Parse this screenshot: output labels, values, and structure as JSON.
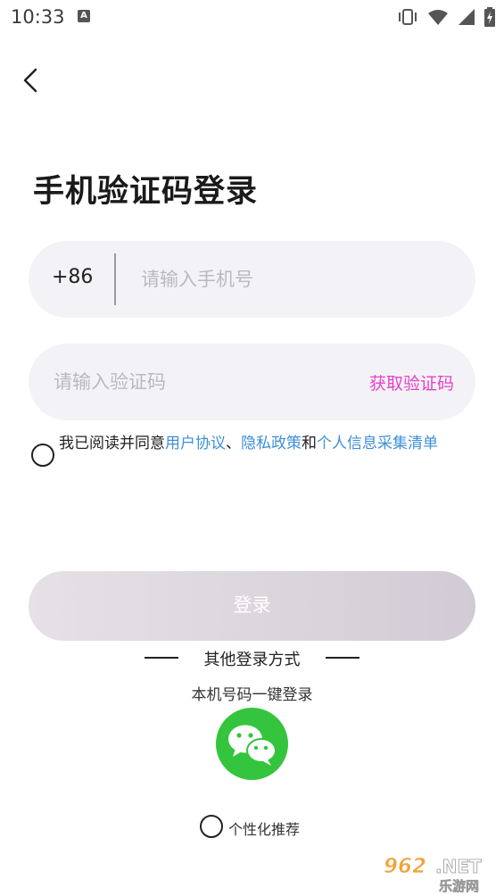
{
  "status_bar": {
    "time": "10:33",
    "notification_badge": "A"
  },
  "page": {
    "title": "手机验证码登录"
  },
  "phone_field": {
    "country_code": "+86",
    "placeholder": "请输入手机号",
    "value": ""
  },
  "code_field": {
    "placeholder": "请输入验证码",
    "value": "",
    "get_code_label": "获取验证码"
  },
  "agreement": {
    "prefix": "我已阅读并同意",
    "link_user": "用户协议",
    "sep1": "、",
    "link_privacy": "隐私政策",
    "sep2": "和",
    "link_info": "个人信息采集清单",
    "checked": false
  },
  "login_button": {
    "label": "登录"
  },
  "other_login": {
    "label": "其他登录方式",
    "one_click": "本机号码一键登录",
    "wechat_icon": "wechat-icon"
  },
  "personalized": {
    "label": "个性化推荐",
    "checked": false
  },
  "watermark": {
    "top": "962.NET",
    "bottom": "乐游网"
  },
  "colors": {
    "accent_pink": "#e83fcb",
    "link_blue": "#3d8fd9",
    "wechat_green": "#35c43d",
    "field_bg": "#f3f3f7"
  }
}
